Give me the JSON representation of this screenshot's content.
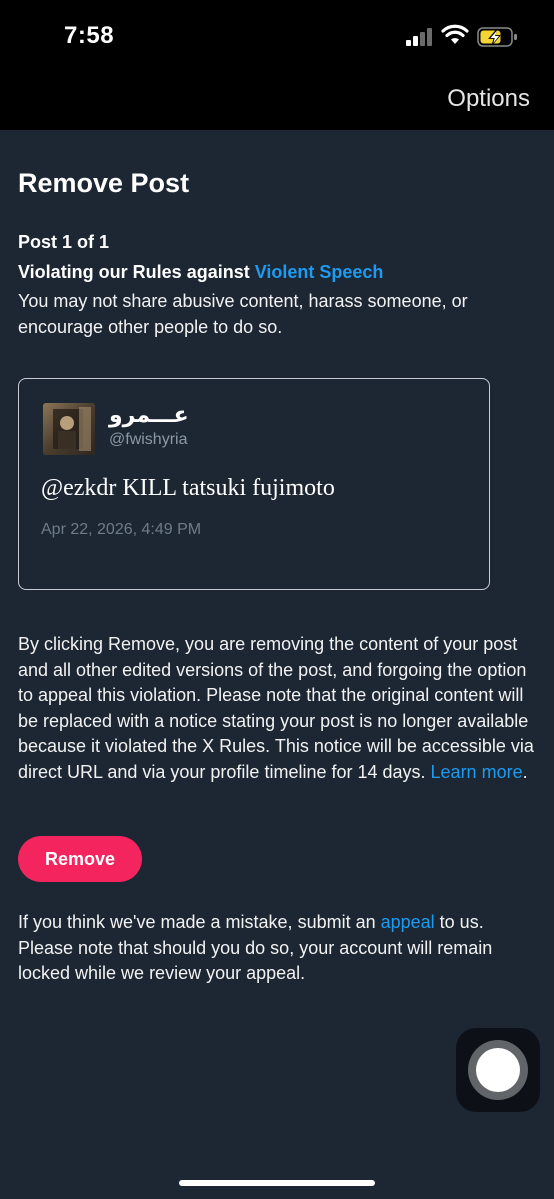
{
  "status_bar": {
    "time": "7:58"
  },
  "nav": {
    "options_label": "Options"
  },
  "page": {
    "title": "Remove Post",
    "post_count": "Post 1 of 1",
    "violation_prefix": "Violating our Rules against ",
    "violation_link": "Violent Speech",
    "policy_description": "You may not share abusive content, harass someone, or encourage other people to do so."
  },
  "post": {
    "display_name": "عـــمرو",
    "handle": "@fwishyria",
    "text": "@ezkdr KILL tatsuki fujimoto",
    "date": "Apr 22, 2026, 4:49 PM"
  },
  "removal": {
    "description": "By clicking Remove, you are removing the content of your post and all other edited versions of the post, and forgoing the option to appeal this violation. Please note that the original content will be replaced with a notice stating your post is no longer available because it violated the X Rules. This notice will be accessible via direct URL and via your profile timeline for 14 days. ",
    "learn_more_link": "Learn more",
    "period": ".",
    "button_label": "Remove"
  },
  "appeal": {
    "text_before": "If you think we've made a mistake, submit an ",
    "link": "appeal",
    "text_after": " to us. Please note that should you do so, your account will remain locked while we review your appeal."
  },
  "colors": {
    "background": "#1d2733",
    "link": "#1d9bf0",
    "remove_button": "#f4245e",
    "battery_charging": "#f5d533"
  },
  "icons": {
    "signal": "cellular-signal-icon",
    "wifi": "wifi-icon",
    "battery": "battery-charging-icon",
    "assistive_touch": "assistive-touch-icon"
  }
}
